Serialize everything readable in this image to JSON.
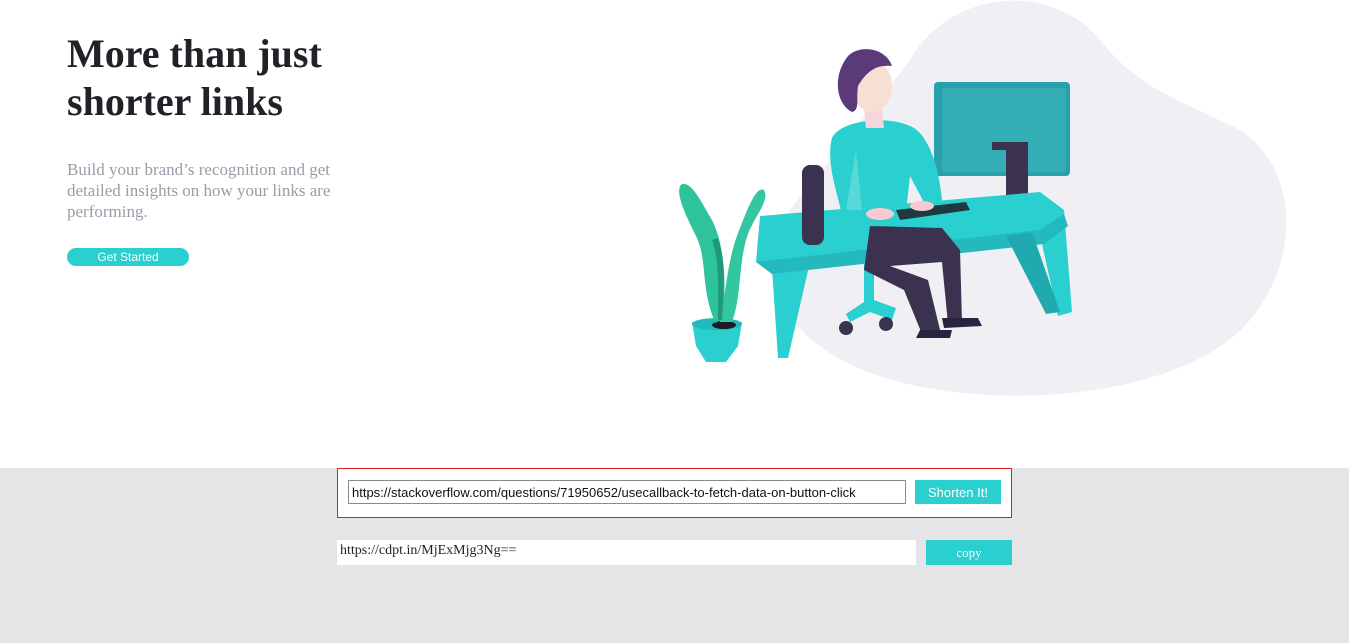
{
  "hero": {
    "title_line1": "More than just",
    "title_line2": "shorter links",
    "subtitle": "Build your brand’s recognition and get detailed insights on how your links are performing.",
    "cta_label": "Get Started"
  },
  "shortener": {
    "input_value": "https://stackoverflow.com/questions/71950652/usecallback-to-fetch-data-on-button-click",
    "button_label": "Shorten It!"
  },
  "result": {
    "short_url": "https://cdpt.in/MjExMjg3Ng==",
    "copy_label": "copy"
  },
  "colors": {
    "accent": "#2acfcf",
    "heading": "#232127",
    "muted": "#9e9aa7",
    "section_bg": "#e5e5e8",
    "highlight_border": "#e02020"
  },
  "illustration": {
    "icon": "person-working-at-desk-illustration"
  }
}
